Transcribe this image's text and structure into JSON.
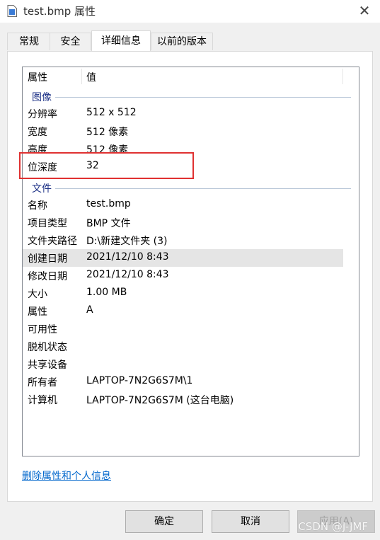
{
  "window": {
    "title": "test.bmp 属性",
    "close_label": "✕"
  },
  "tabs": [
    {
      "label": "常规"
    },
    {
      "label": "安全"
    },
    {
      "label": "详细信息"
    },
    {
      "label": "以前的版本"
    }
  ],
  "active_tab": "详细信息",
  "list": {
    "columns": {
      "property": "属性",
      "value": "值"
    },
    "groups": [
      {
        "name": "图像",
        "rows": [
          {
            "key": "分辨率",
            "value": "512 x 512"
          },
          {
            "key": "宽度",
            "value": "512 像素"
          },
          {
            "key": "高度",
            "value": "512 像素"
          },
          {
            "key": "位深度",
            "value": "32"
          }
        ]
      },
      {
        "name": "文件",
        "rows": [
          {
            "key": "名称",
            "value": "test.bmp"
          },
          {
            "key": "项目类型",
            "value": "BMP 文件"
          },
          {
            "key": "文件夹路径",
            "value": "D:\\新建文件夹 (3)"
          },
          {
            "key": "创建日期",
            "value": "2021/12/10 8:43"
          },
          {
            "key": "修改日期",
            "value": "2021/12/10 8:43"
          },
          {
            "key": "大小",
            "value": "1.00 MB"
          },
          {
            "key": "属性",
            "value": "A"
          },
          {
            "key": "可用性",
            "value": ""
          },
          {
            "key": "脱机状态",
            "value": ""
          },
          {
            "key": "共享设备",
            "value": ""
          },
          {
            "key": "所有者",
            "value": "LAPTOP-7N2G6S7M\\1"
          },
          {
            "key": "计算机",
            "value": "LAPTOP-7N2G6S7M (这台电脑)"
          }
        ]
      }
    ],
    "highlighted_row": "创建日期"
  },
  "link": {
    "label": "删除属性和个人信息"
  },
  "buttons": {
    "ok": "确定",
    "cancel": "取消",
    "apply": "应用(A)"
  },
  "watermark": "CSDN @J-JMF",
  "colors": {
    "annotation": "#e03131",
    "group_header": "#1e3287",
    "link": "#0066cc"
  }
}
